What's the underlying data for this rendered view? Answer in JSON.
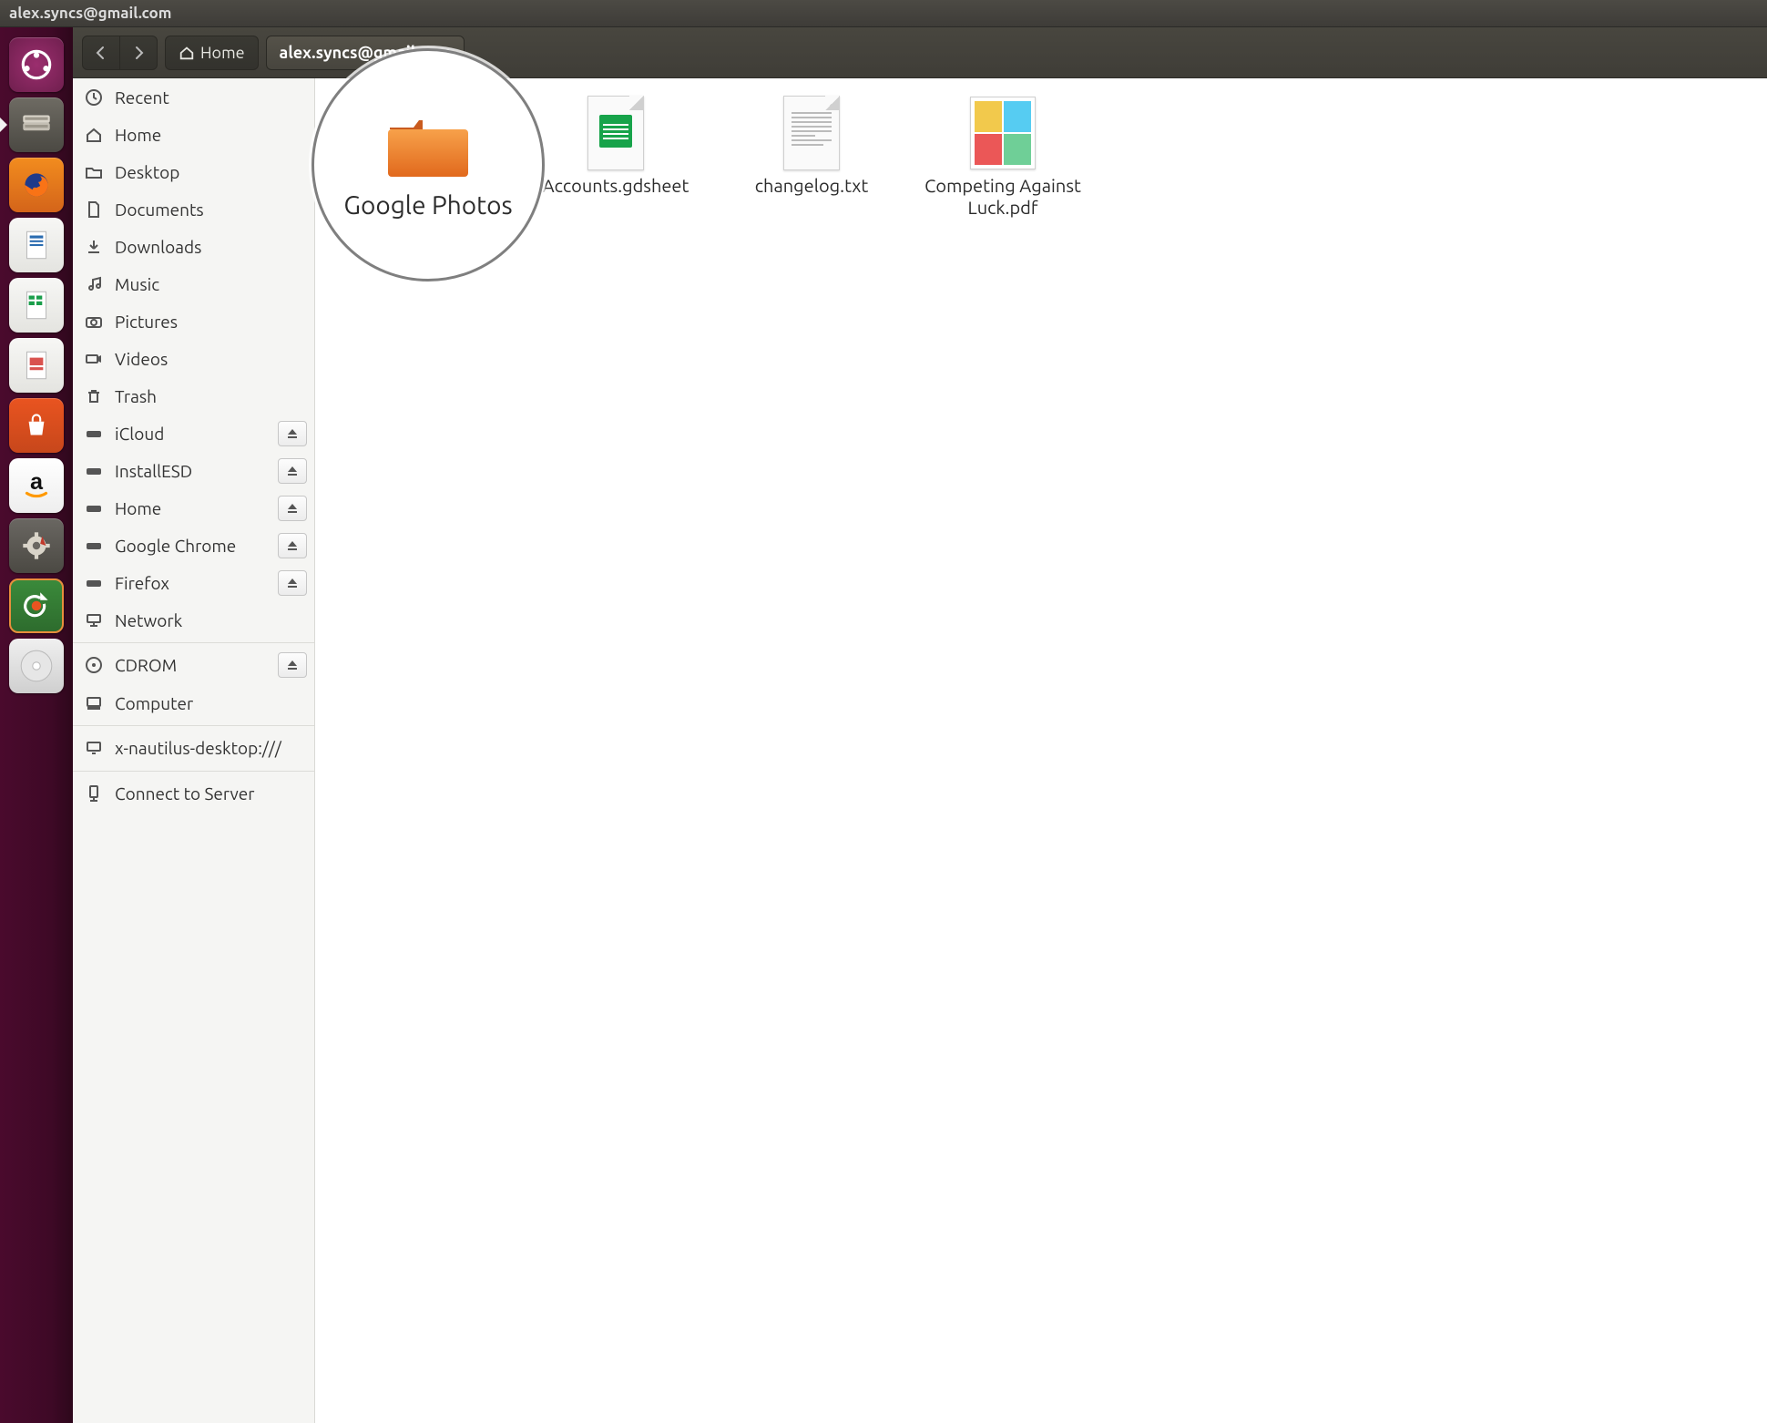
{
  "window": {
    "title": "alex.syncs@gmail.com"
  },
  "toolbar": {
    "back_icon": "chevron-left",
    "forward_icon": "chevron-right",
    "crumbs": [
      {
        "label": "Home",
        "is_home": true
      },
      {
        "label": "alex.syncs@gmail.com",
        "active": true
      }
    ]
  },
  "launcher": {
    "apps": [
      {
        "name": "dash-icon"
      },
      {
        "name": "files-icon"
      },
      {
        "name": "firefox-icon"
      },
      {
        "name": "writer-icon"
      },
      {
        "name": "calc-icon"
      },
      {
        "name": "impress-icon"
      },
      {
        "name": "software-center-icon"
      },
      {
        "name": "amazon-icon"
      },
      {
        "name": "settings-icon"
      },
      {
        "name": "software-updater-icon"
      },
      {
        "name": "disc-icon"
      }
    ]
  },
  "places": [
    {
      "label": "Recent",
      "icon": "clock-icon"
    },
    {
      "label": "Home",
      "icon": "home-icon"
    },
    {
      "label": "Desktop",
      "icon": "folder-icon"
    },
    {
      "label": "Documents",
      "icon": "document-icon"
    },
    {
      "label": "Downloads",
      "icon": "download-icon"
    },
    {
      "label": "Music",
      "icon": "music-icon"
    },
    {
      "label": "Pictures",
      "icon": "camera-icon"
    },
    {
      "label": "Videos",
      "icon": "video-icon"
    },
    {
      "label": "Trash",
      "icon": "trash-icon"
    },
    {
      "label": "iCloud",
      "icon": "drive-icon",
      "ejectable": true
    },
    {
      "label": "InstallESD",
      "icon": "drive-icon",
      "ejectable": true
    },
    {
      "label": "Home",
      "icon": "drive-icon",
      "ejectable": true
    },
    {
      "label": "Google Chrome",
      "icon": "drive-icon",
      "ejectable": true
    },
    {
      "label": "Firefox",
      "icon": "drive-icon",
      "ejectable": true
    },
    {
      "label": "Network",
      "icon": "network-icon"
    },
    {
      "label": "CDROM",
      "icon": "cd-icon",
      "ejectable": true,
      "separated": true
    },
    {
      "label": "Computer",
      "icon": "computer-icon"
    },
    {
      "label": "x-nautilus-desktop:///",
      "icon": "desktop-icon",
      "separated": true
    },
    {
      "label": "Connect to Server",
      "icon": "server-icon",
      "separated": true
    }
  ],
  "highlight": {
    "label": "Google Photos"
  },
  "files": [
    {
      "label": "Accounts.gdsheet",
      "kind": "spreadsheet"
    },
    {
      "label": "changelog.txt",
      "kind": "text"
    },
    {
      "label": "Competing Against\nLuck.pdf",
      "kind": "pdf"
    }
  ]
}
